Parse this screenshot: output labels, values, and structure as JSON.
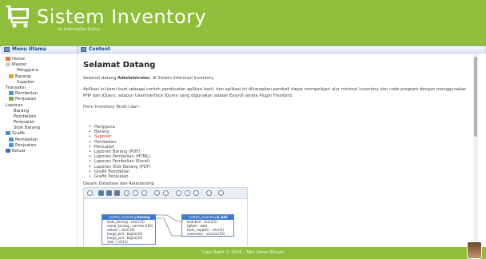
{
  "header": {
    "title": "Sistem Inventory",
    "subtitle": "by Informatika Kudus"
  },
  "left_panel": {
    "title": "Menu Utama",
    "items": [
      {
        "label": "Home",
        "icon": "home-icon"
      },
      {
        "label": "Master",
        "icon": "folder-icon"
      },
      {
        "label": "Pengguna",
        "icon": ""
      },
      {
        "label": "Barang",
        "icon": "box-icon"
      },
      {
        "label": "Supplier",
        "icon": ""
      },
      {
        "label": "Transaksi",
        "icon": ""
      },
      {
        "label": "Pembelian",
        "icon": "cart-icon"
      },
      {
        "label": "Penjualan",
        "icon": "cash-icon"
      },
      {
        "label": "Laporan",
        "icon": ""
      },
      {
        "label": "Barang",
        "icon": ""
      },
      {
        "label": "Pembelian",
        "icon": ""
      },
      {
        "label": "Penjualan",
        "icon": ""
      },
      {
        "label": "Stok Barang",
        "icon": ""
      },
      {
        "label": "Grafik",
        "icon": "chart-icon"
      },
      {
        "label": "Pembelian",
        "icon": "chart-icon"
      },
      {
        "label": "Penjualan",
        "icon": "chart-icon"
      },
      {
        "label": "Keluar",
        "icon": "exit-icon"
      }
    ]
  },
  "content": {
    "title": "Content",
    "heading": "Selamat Datang",
    "welcome_pre": "Selamat datang ",
    "welcome_user": "Administrator",
    "welcome_post": ", di Sistem Informasi Inventory.",
    "desc_line1": "Aplikasi ini kami buat sebagai contoh pembuatan aplikasi kecil, dan aplikasi ini diharapkan pembeli dapat mempelajari alur minimal inventory dan code program dengan menggunakan",
    "desc_line2": "PHP dan JQuery, adapun UserInterface JQuery yang digunakan adalah EasyUI serata Plugin FlexiGrid.",
    "form_intro": "Form Inventory Terdiri dari :",
    "forms": [
      {
        "label": "Pengguna",
        "highlight": false
      },
      {
        "label": "Barang",
        "highlight": false
      },
      {
        "label": "Supplier",
        "highlight": true
      },
      {
        "label": "Pembelian",
        "highlight": false
      },
      {
        "label": "Penjualan",
        "highlight": false
      },
      {
        "label": "Laporan Barang (PDF)",
        "highlight": false
      },
      {
        "label": "Laporan Pembelian (HTML)",
        "highlight": false
      },
      {
        "label": "Laporan Pembelian (Excel)",
        "highlight": false
      },
      {
        "label": "Laporan Stok Barang (PDF)",
        "highlight": false
      },
      {
        "label": "Grafik Pembelian",
        "highlight": false
      },
      {
        "label": "Grafik Penjualan",
        "highlight": false
      }
    ],
    "diagram_caption": "Desain Database dan Relationship",
    "diagram": {
      "table1_db": "contoh_inventory",
      "table1_name": "barang",
      "table1_fields": [
        "kode_barang : char(15)",
        "nama_barang : varchar(100)",
        "satuan : char(10)",
        "harga_beli : bigint(20)",
        "harga_jual : bigint(20)",
        "stok : int(11)"
      ],
      "table2_db": "contoh_inventory",
      "table2_name": "h_beli",
      "table2_fields": [
        "kodebeli : char(15)",
        "tglbeli : date",
        "kode_supplier : char(5)",
        "username : varchar(50)"
      ]
    }
  },
  "footer": {
    "text": "Copy Right © 2016 - Toko Umon Binuen"
  },
  "colors": {
    "header": "#8fbf3a",
    "panel_title": "#15428b",
    "highlight": "#cc3333"
  }
}
